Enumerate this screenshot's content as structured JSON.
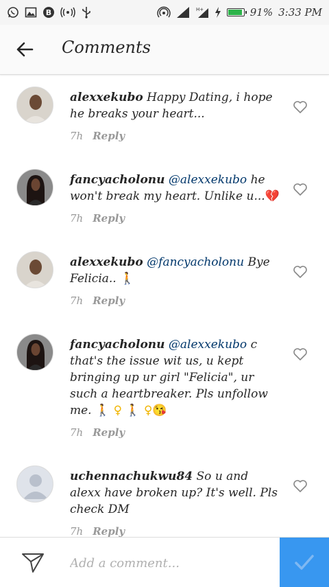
{
  "status_bar": {
    "battery_percent": "91%",
    "time": "3:33 PM",
    "icons_left": [
      "whatsapp-icon",
      "gallery-icon",
      "bbm-icon",
      "hotspot-icon",
      "usb-icon"
    ],
    "icons_right": [
      "wifi-hotspot-icon",
      "signal-icon",
      "signal-ht-icon",
      "charging-icon",
      "battery-icon"
    ],
    "battery_color": "#2db34a"
  },
  "header": {
    "title": "Comments"
  },
  "comments": [
    {
      "username": "alexxekubo",
      "mention": "",
      "text": "Happy Dating, i hope he breaks your heart...",
      "emoji": "",
      "time": "7h",
      "reply_label": "Reply"
    },
    {
      "username": "fancyacholonu",
      "mention": "@alexxekubo",
      "text": "he won't break my heart. Unlike u...",
      "emoji": "💔",
      "time": "7h",
      "reply_label": "Reply"
    },
    {
      "username": "alexxekubo",
      "mention": "@fancyacholonu",
      "text": "Bye Felicia..",
      "emoji": "🚶",
      "time": "7h",
      "reply_label": "Reply"
    },
    {
      "username": "fancyacholonu",
      "mention": "@alexxekubo",
      "text": "c that's the issue wit us, u kept bringing up ur girl \"Felicia\", ur such a heartbreaker. Pls unfollow me.",
      "emoji": "🚶 ♀ 🚶 ♀😘",
      "time": "7h",
      "reply_label": "Reply"
    },
    {
      "username": "uchennachukwu84",
      "mention": "",
      "text": "So u and alexx have broken up? It's well. Pls check DM",
      "emoji": "",
      "time": "7h",
      "reply_label": "Reply"
    }
  ],
  "composer": {
    "placeholder": "Add a comment...",
    "value": "",
    "post_color": "#3897f0"
  }
}
